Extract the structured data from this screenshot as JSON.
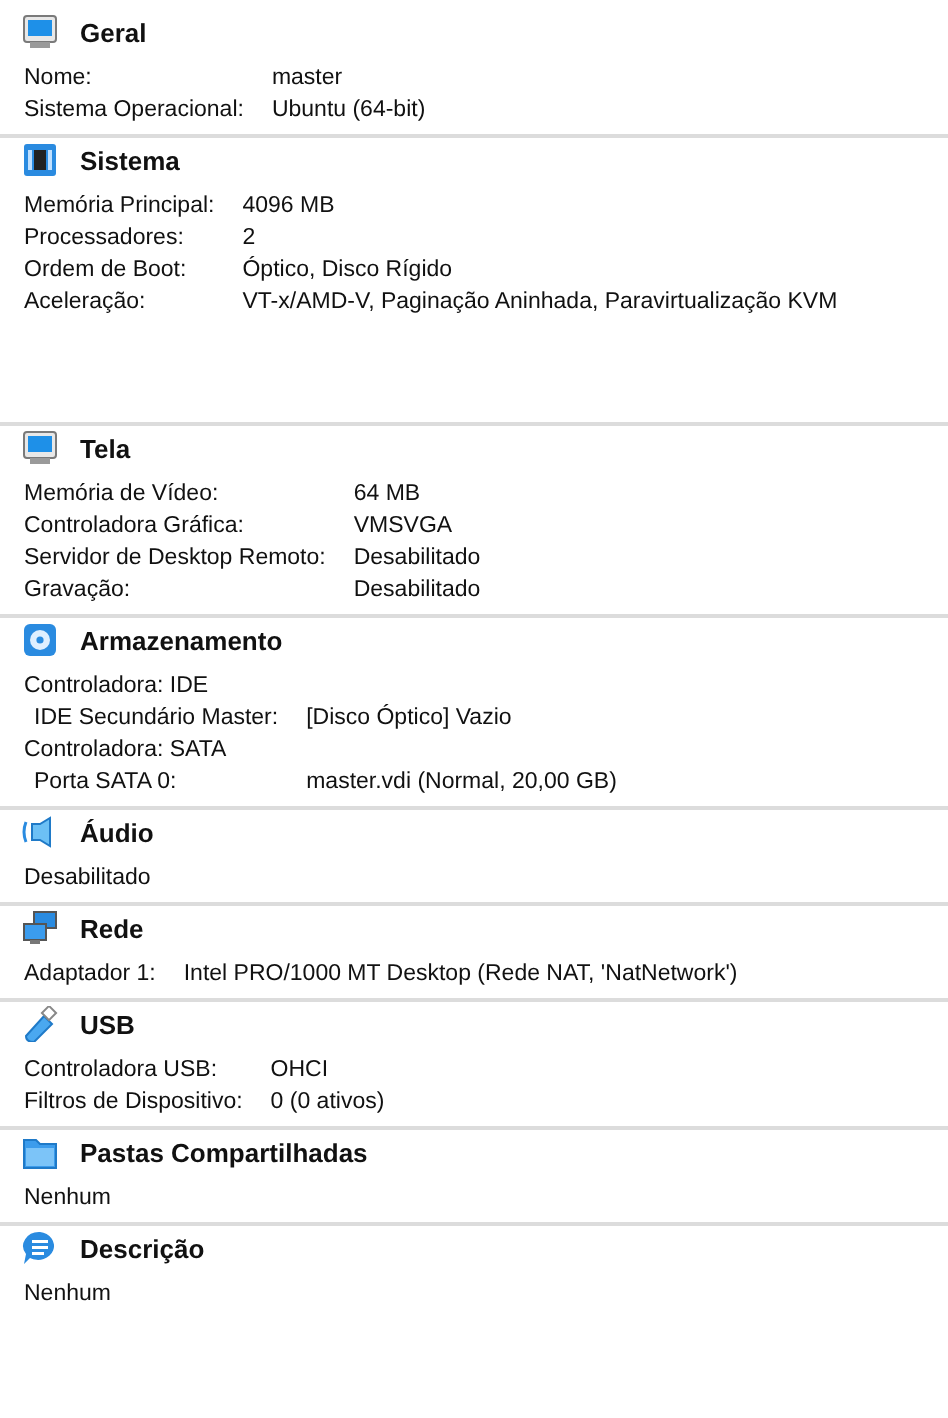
{
  "sections": [
    {
      "kind": "general",
      "title": "Geral",
      "rows": [
        {
          "kind": "pair",
          "label": "Nome:",
          "value": "master"
        },
        {
          "kind": "pair",
          "label": "Sistema Operacional:",
          "value": "Ubuntu (64-bit)"
        }
      ]
    },
    {
      "kind": "system",
      "title": "Sistema",
      "rows": [
        {
          "kind": "pair",
          "label": "Memória Principal:",
          "value": "4096 MB"
        },
        {
          "kind": "pair",
          "label": "Processadores:",
          "value": "2"
        },
        {
          "kind": "pair",
          "label": "Ordem de Boot:",
          "value": "Óptico, Disco Rígido"
        },
        {
          "kind": "pair",
          "label": "Aceleração:",
          "value": "VT-x/AMD-V, Paginação Aninhada, Paravirtualização KVM"
        }
      ]
    },
    {
      "kind": "display",
      "title": "Tela",
      "rows": [
        {
          "kind": "pair",
          "label": "Memória de Vídeo:",
          "value": "64 MB"
        },
        {
          "kind": "pair",
          "label": "Controladora Gráfica:",
          "value": "VMSVGA"
        },
        {
          "kind": "pair",
          "label": "Servidor de Desktop Remoto:",
          "value": "Desabilitado"
        },
        {
          "kind": "pair",
          "label": "Gravação:",
          "value": "Desabilitado"
        }
      ]
    },
    {
      "kind": "storage",
      "title": "Armazenamento",
      "rows": [
        {
          "kind": "group",
          "text": "Controladora: IDE"
        },
        {
          "kind": "subpair",
          "label": "IDE Secundário Master:",
          "value": "[Disco Óptico] Vazio"
        },
        {
          "kind": "group",
          "text": "Controladora: SATA"
        },
        {
          "kind": "subpair",
          "label": "Porta SATA 0:",
          "value": "master.vdi (Normal, 20,00 GB)"
        }
      ]
    },
    {
      "kind": "audio",
      "title": "Áudio",
      "rows": [
        {
          "kind": "group",
          "text": "Desabilitado"
        }
      ]
    },
    {
      "kind": "network",
      "title": "Rede",
      "rows": [
        {
          "kind": "pair",
          "label": "Adaptador 1:",
          "value": "Intel PRO/1000 MT Desktop (Rede NAT, 'NatNetwork')"
        }
      ]
    },
    {
      "kind": "usb",
      "title": "USB",
      "rows": [
        {
          "kind": "pair",
          "label": "Controladora USB:",
          "value": "OHCI"
        },
        {
          "kind": "pair",
          "label": "Filtros de Dispositivo:",
          "value": "0 (0 ativos)"
        }
      ]
    },
    {
      "kind": "folders",
      "title": "Pastas Compartilhadas",
      "rows": [
        {
          "kind": "group",
          "text": "Nenhum"
        }
      ]
    },
    {
      "kind": "description",
      "title": "Descrição",
      "rows": [
        {
          "kind": "group",
          "text": "Nenhum"
        }
      ]
    }
  ]
}
